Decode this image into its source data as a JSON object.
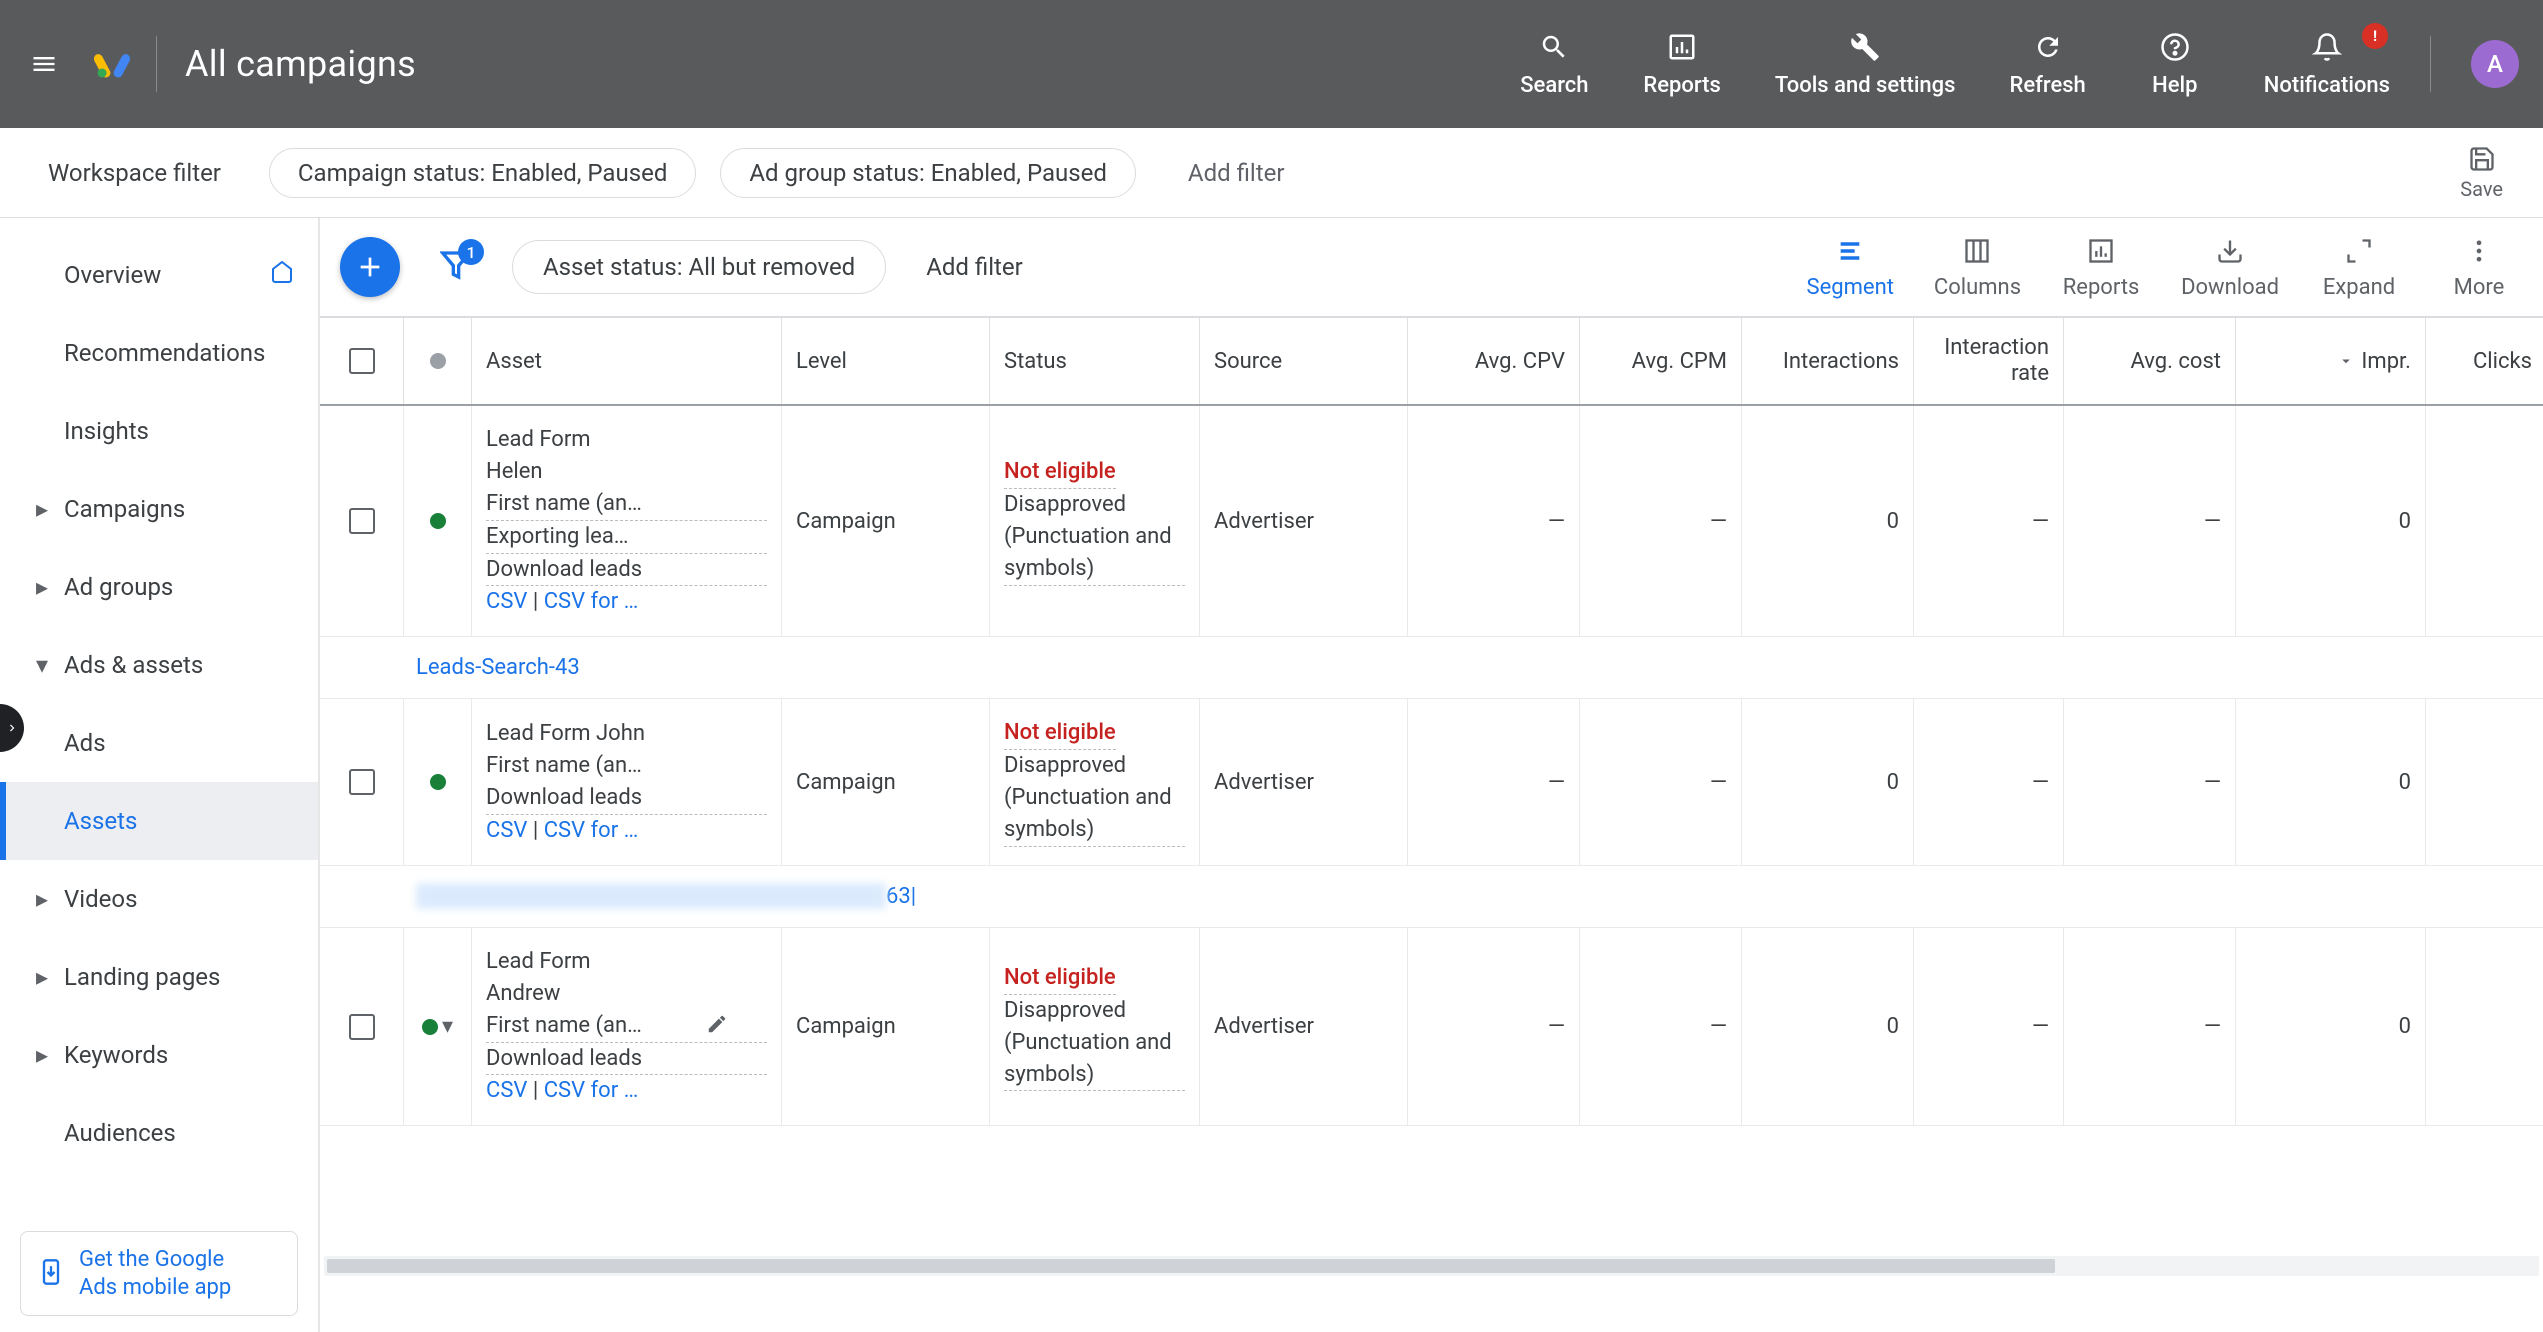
{
  "header": {
    "title": "All campaigns",
    "actions": {
      "search": "Search",
      "reports": "Reports",
      "tools": "Tools and settings",
      "refresh": "Refresh",
      "help": "Help",
      "notifications": "Notifications",
      "notif_badge": "!"
    },
    "avatar_initial": "A"
  },
  "filterbar": {
    "workspace": "Workspace filter",
    "chip1": "Campaign status: Enabled, Paused",
    "chip2": "Ad group status: Enabled, Paused",
    "addfilter": "Add filter",
    "save": "Save"
  },
  "sidebar": {
    "overview": "Overview",
    "recommendations": "Recommendations",
    "insights": "Insights",
    "campaigns": "Campaigns",
    "adgroups": "Ad groups",
    "adsassets": "Ads & assets",
    "ads": "Ads",
    "assets": "Assets",
    "videos": "Videos",
    "landing": "Landing pages",
    "keywords": "Keywords",
    "audiences": "Audiences",
    "promo1": "Get the Google",
    "promo2": "Ads mobile app"
  },
  "toolbar": {
    "filter_badge": "1",
    "chip": "Asset status: All but removed",
    "addfilter": "Add filter",
    "segment": "Segment",
    "columns": "Columns",
    "reports": "Reports",
    "download": "Download",
    "expand": "Expand",
    "more": "More"
  },
  "columns": {
    "asset": "Asset",
    "level": "Level",
    "status": "Status",
    "source": "Source",
    "avgcpv": "Avg. CPV",
    "avgcpm": "Avg. CPM",
    "interactions": "Interactions",
    "irate1": "Interaction",
    "irate2": "rate",
    "avgcost": "Avg. cost",
    "impr": "Impr.",
    "clicks": "Clicks"
  },
  "groups": [
    {
      "label": "Leads-Search-43"
    },
    {
      "label_suffix": "63|"
    }
  ],
  "rows": [
    {
      "name_l1": "Lead Form",
      "name_l2": "Helen",
      "name_l3": "First name (an…",
      "name_l4": "Exporting lea…",
      "dl": "Download leads",
      "csv": "CSV",
      "csv2": "CSV for …",
      "level": "Campaign",
      "status_ne": "Not eligible",
      "status_dis": "Disapproved (Punctuation and symbols)",
      "source": "Advertiser",
      "cpv": "—",
      "cpm": "—",
      "inter": "0",
      "irate": "—",
      "avgcost": "—",
      "impr": "0",
      "clicks": ""
    },
    {
      "name_l1": "Lead Form John",
      "name_l2": "First name (an…",
      "dl": "Download leads",
      "csv": "CSV",
      "csv2": "CSV for …",
      "level": "Campaign",
      "status_ne": "Not eligible",
      "status_dis": "Disapproved (Punctuation and symbols)",
      "source": "Advertiser",
      "cpv": "—",
      "cpm": "—",
      "inter": "0",
      "irate": "—",
      "avgcost": "—",
      "impr": "0",
      "clicks": ""
    },
    {
      "name_l1": "Lead Form",
      "name_l2": "Andrew",
      "name_l3": "First name (an…",
      "dl": "Download leads",
      "csv": "CSV",
      "csv2": "CSV for …",
      "level": "Campaign",
      "status_ne": "Not eligible",
      "status_dis": "Disapproved (Punctuation and symbols)",
      "source": "Advertiser",
      "cpv": "—",
      "cpm": "—",
      "inter": "0",
      "irate": "—",
      "avgcost": "—",
      "impr": "0",
      "clicks": "",
      "has_edit": true,
      "has_caret": true
    }
  ]
}
